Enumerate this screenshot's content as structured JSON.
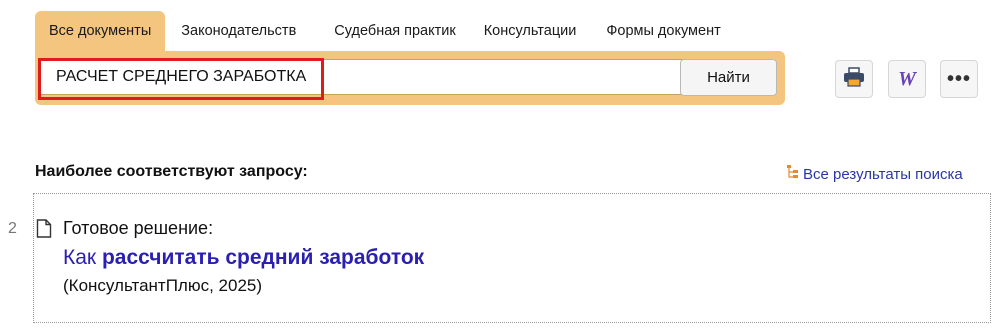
{
  "tabs": [
    {
      "label": "Все документы",
      "active": true
    },
    {
      "label": "Законодательств",
      "active": false
    },
    {
      "label": "Судебная практик",
      "active": false
    },
    {
      "label": "Консультации",
      "active": false
    },
    {
      "label": "Формы документ",
      "active": false
    }
  ],
  "search": {
    "value": "РАСЧЕТ СРЕДНЕГО ЗАРАБОТКА",
    "clear_label": "×",
    "button_label": "Найти"
  },
  "toolbar": {
    "print_icon": "print-icon",
    "word_label": "W",
    "more_label": "•••"
  },
  "results": {
    "heading": "Наиболее соответствуют запросу:",
    "all_results_label": "Все результаты поиска",
    "items": [
      {
        "number": "2",
        "type": "Готовое решение:",
        "title_prefix": "Как ",
        "title_bold": "рассчитать средний заработок",
        "source": "(КонсультантПлюс, 2025)"
      }
    ]
  },
  "colors": {
    "accent": "#f4c57e",
    "link": "#2a1fb0",
    "highlight": "#e01b1b"
  }
}
